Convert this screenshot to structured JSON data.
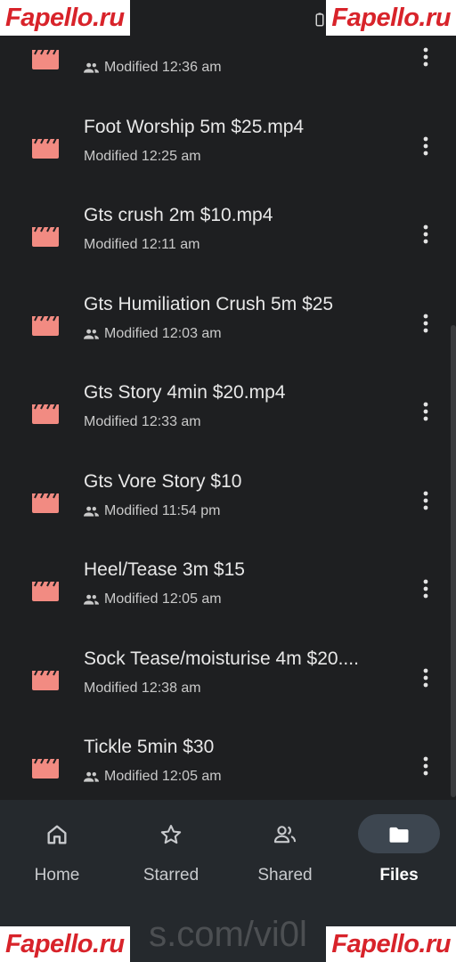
{
  "files": [
    {
      "title": "",
      "modified": "Modified 12:36 am",
      "shared": true
    },
    {
      "title": "Foot Worship 5m $25.mp4",
      "modified": "Modified 12:25 am",
      "shared": false
    },
    {
      "title": "Gts crush 2m $10.mp4",
      "modified": "Modified 12:11 am",
      "shared": false
    },
    {
      "title": "Gts Humiliation Crush 5m $25",
      "modified": "Modified 12:03 am",
      "shared": true
    },
    {
      "title": "Gts Story 4min $20.mp4",
      "modified": "Modified 12:33 am",
      "shared": false
    },
    {
      "title": "Gts Vore Story $10",
      "modified": "Modified 11:54 pm",
      "shared": true
    },
    {
      "title": "Heel/Tease 3m $15",
      "modified": "Modified 12:05 am",
      "shared": true
    },
    {
      "title": "Sock Tease/moisturise 4m $20....",
      "modified": "Modified 12:38 am",
      "shared": false
    },
    {
      "title": "Tickle 5min $30",
      "modified": "Modified 12:05 am",
      "shared": true
    }
  ],
  "nav": {
    "home": "Home",
    "starred": "Starred",
    "shared": "Shared",
    "files": "Files",
    "active": "files"
  },
  "watermark": {
    "brand": "Fapello.ru",
    "url": "s.com/vi0l"
  },
  "colors": {
    "file_icon": "#f28b82",
    "background": "#1e1f21",
    "nav_background": "#25292d",
    "active_pill": "#3d4650"
  },
  "icons": {
    "file": "video-file-icon",
    "shared": "people-icon",
    "more": "more-vert-icon"
  }
}
